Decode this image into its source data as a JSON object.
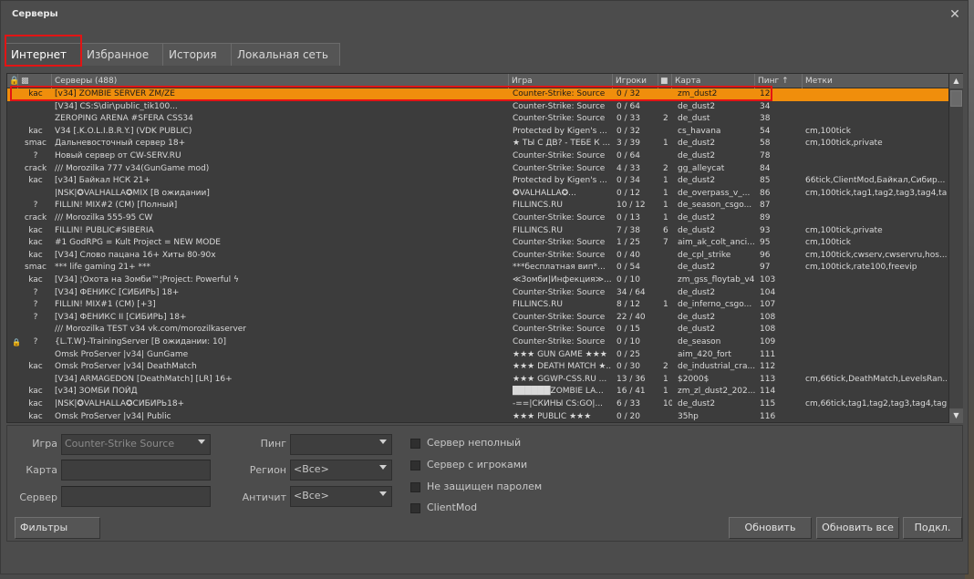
{
  "window": {
    "title": "Серверы",
    "close_glyph": "✕"
  },
  "tabs": [
    {
      "label": "Интернет"
    },
    {
      "label": "Избранное"
    },
    {
      "label": "История"
    },
    {
      "label": "Локальная сеть"
    }
  ],
  "columns": {
    "lock_icon": "lock-icon",
    "vac_icon": "vac-shield-icon",
    "servers": "Серверы (488)",
    "game": "Игра",
    "players": "Игроки",
    "bots_icon": "bot-icon",
    "map": "Карта",
    "ping": "Пинг ↑",
    "tags": "Метки"
  },
  "rows": [
    {
      "pw": "",
      "vac": "kac",
      "name": "[v34] ZOMBIE SERVER ZM/ZE",
      "game": "Counter-Strike: Source",
      "players": "0 / 32",
      "bots": "",
      "map": "zm_dust2",
      "ping": "12",
      "tags": "",
      "selected": true
    },
    {
      "pw": "",
      "vac": "",
      "name": "[V34] CS:S\\dir\\public_tik100...",
      "game": "Counter-Strike: Source",
      "players": "0 / 64",
      "bots": "",
      "map": "de_dust2",
      "ping": "34",
      "tags": ""
    },
    {
      "pw": "",
      "vac": "",
      "name": "ZEROPING ARENA #SFERA CSS34",
      "game": "Counter-Strike: Source",
      "players": "0 / 33",
      "bots": "2",
      "map": "de_dust",
      "ping": "38",
      "tags": ""
    },
    {
      "pw": "",
      "vac": "kac",
      "name": "V34 [.K.O.L.I.B.R.Y.] (VDK PUBLIC)",
      "game": "Protected by Kigen's ...",
      "players": "0 / 32",
      "bots": "",
      "map": "cs_havana",
      "ping": "54",
      "tags": "cm,100tick"
    },
    {
      "pw": "",
      "vac": "smac",
      "name": "Дальневосточный сервер 18+",
      "game": "★ ТЫ С ДВ? - ТЕБЕ К ...",
      "players": "3 / 39",
      "bots": "1",
      "map": "de_dust2",
      "ping": "58",
      "tags": "cm,100tick,private"
    },
    {
      "pw": "",
      "vac": "?",
      "name": "Новый сервер от CW-SERV.RU",
      "game": "Counter-Strike: Source",
      "players": "0 / 64",
      "bots": "",
      "map": "de_dust2",
      "ping": "78",
      "tags": ""
    },
    {
      "pw": "",
      "vac": "crack",
      "name": "/// Morozilka 777 v34(GunGame mod)",
      "game": "Counter-Strike: Source",
      "players": "4 / 33",
      "bots": "2",
      "map": "gg_alleycat",
      "ping": "84",
      "tags": ""
    },
    {
      "pw": "",
      "vac": "kac",
      "name": "[v34] Байкал НСК 21+",
      "game": "Protected by Kigen's ...",
      "players": "0 / 34",
      "bots": "1",
      "map": "de_dust2",
      "ping": "85",
      "tags": "66tick,ClientMod,Байкал,Сибир..."
    },
    {
      "pw": "",
      "vac": "",
      "name": "|NSK|✪VALHALLA✪MIX [В ожидании]",
      "game": "✪VALHALLA✪...",
      "players": "0 / 12",
      "bots": "1",
      "map": "de_overpass_v_...",
      "ping": "86",
      "tags": "cm,100tick,tag1,tag2,tag3,tag4,ta..."
    },
    {
      "pw": "",
      "vac": "?",
      "name": "FILLIN! MIX#2 (CM) [Полный]",
      "game": "FILLINCS.RU",
      "players": "10 / 12",
      "bots": "1",
      "map": "de_season_csgo...",
      "ping": "87",
      "tags": ""
    },
    {
      "pw": "",
      "vac": "crack",
      "name": "/// Morozilka 555-95 CW",
      "game": "Counter-Strike: Source",
      "players": "0 / 13",
      "bots": "1",
      "map": "de_dust2",
      "ping": "89",
      "tags": ""
    },
    {
      "pw": "",
      "vac": "kac",
      "name": "FILLIN! PUBLIC#SIBERIA",
      "game": "FILLINCS.RU",
      "players": "7 / 38",
      "bots": "6",
      "map": "de_dust2",
      "ping": "93",
      "tags": "cm,100tick,private"
    },
    {
      "pw": "",
      "vac": "kac",
      "name": "#1 GodRPG = Kult Project = NEW MODE",
      "game": "Counter-Strike: Source",
      "players": "1 / 25",
      "bots": "7",
      "map": "aim_ak_colt_anci...",
      "ping": "95",
      "tags": "cm,100tick"
    },
    {
      "pw": "",
      "vac": "kac",
      "name": "[V34] Слово пацана 16+ Хиты 80-90х",
      "game": "Counter-Strike: Source",
      "players": "0 / 40",
      "bots": "",
      "map": "de_cpl_strike",
      "ping": "96",
      "tags": "cm,100tick,cwserv,cwservru,hos..."
    },
    {
      "pw": "",
      "vac": "smac",
      "name": "*** life gaming 21+ ***",
      "game": "***бесплатная вип*...",
      "players": "0 / 54",
      "bots": "",
      "map": "de_dust2",
      "ping": "97",
      "tags": "cm,100tick,rate100,freevip"
    },
    {
      "pw": "",
      "vac": "kac",
      "name": "[V34] ¦Охота на Зомби™¦Project: Powerful ϟ",
      "game": "≪Зомби|Инфекция≫...",
      "players": "0 / 10",
      "bots": "",
      "map": "zm_gss_floytab_v4",
      "ping": "103",
      "tags": ""
    },
    {
      "pw": "",
      "vac": "?",
      "name": "[V34] ФЕНИКС [СИБИРЬ] 18+",
      "game": "Counter-Strike: Source",
      "players": "34 / 64",
      "bots": "",
      "map": "de_dust2",
      "ping": "104",
      "tags": ""
    },
    {
      "pw": "",
      "vac": "?",
      "name": "FILLIN! MIX#1 (CM) [+3]",
      "game": "FILLINCS.RU",
      "players": "8 / 12",
      "bots": "1",
      "map": "de_inferno_csgo...",
      "ping": "107",
      "tags": ""
    },
    {
      "pw": "",
      "vac": "?",
      "name": "[V34] ФЕНИКС II [СИБИРЬ] 18+",
      "game": "Counter-Strike: Source",
      "players": "22 / 40",
      "bots": "",
      "map": "de_dust2",
      "ping": "108",
      "tags": ""
    },
    {
      "pw": "",
      "vac": "",
      "name": "/// Morozilka TEST v34 vk.com/morozilkaserver",
      "game": "Counter-Strike: Source",
      "players": "0 / 15",
      "bots": "",
      "map": "de_dust2",
      "ping": "108",
      "tags": ""
    },
    {
      "pw": "lock",
      "vac": "?",
      "name": "{L.T.W}-TrainingServer [В ожидании: 10]",
      "game": "Counter-Strike: Source",
      "players": "0 / 10",
      "bots": "",
      "map": "de_season",
      "ping": "109",
      "tags": ""
    },
    {
      "pw": "",
      "vac": "",
      "name": "        Omsk ProServer |v34| GunGame",
      "game": "★★★ GUN GAME ★★★",
      "players": "0 / 25",
      "bots": "",
      "map": "aim_420_fort",
      "ping": "111",
      "tags": ""
    },
    {
      "pw": "",
      "vac": "kac",
      "name": "        Omsk ProServer |v34| DeathMatch",
      "game": "★★★ DEATH MATCH ★...",
      "players": "0 / 30",
      "bots": "2",
      "map": "de_industrial_cra...",
      "ping": "112",
      "tags": ""
    },
    {
      "pw": "",
      "vac": "",
      "name": "[V34] ARMAGEDON [DeathMatch] [LR] 16+",
      "game": "★★★ GGWP-CSS.RU ...",
      "players": "13 / 36",
      "bots": "1",
      "map": "$2000$",
      "ping": "113",
      "tags": "cm,66tick,DeathMatch,LevelsRan..."
    },
    {
      "pw": "",
      "vac": "kac",
      "name": "[v34] ЗОМБИ ПОЙД",
      "game": "██████ZOMBIE LA...",
      "players": "16 / 41",
      "bots": "1",
      "map": "zm_zl_dust2_202...",
      "ping": "114",
      "tags": ""
    },
    {
      "pw": "",
      "vac": "kac",
      "name": "|NSK|✪VALHALLA✪СИБИРЬ18+",
      "game": "-==|СКИНЫ CS:GO|...",
      "players": "6 / 33",
      "bots": "10",
      "map": "de_dust2",
      "ping": "115",
      "tags": "cm,66tick,tag1,tag2,tag3,tag4,tagr"
    },
    {
      "pw": "",
      "vac": "kac",
      "name": "        Omsk ProServer |v34| Public",
      "game": "★★★ PUBLIC ★★★",
      "players": "0 / 20",
      "bots": "",
      "map": "35hp",
      "ping": "116",
      "tags": ""
    }
  ],
  "scrollbar": {
    "up": "▲",
    "down": "▼"
  },
  "filters": {
    "game_label": "Игра",
    "game_value": "Counter-Strike Source",
    "map_label": "Карта",
    "map_value": "",
    "server_label": "Сервер",
    "server_value": "",
    "ping_label": "Пинг",
    "ping_value": "",
    "region_label": "Регион",
    "region_value": "<Все>",
    "anticheat_label": "Античит",
    "anticheat_value": "<Все>",
    "checkboxes": [
      {
        "label": "Сервер неполный",
        "checked": false
      },
      {
        "label": "Сервер с игроками",
        "checked": false
      },
      {
        "label": "Не защищен паролем",
        "checked": false
      },
      {
        "label": "ClientMod",
        "checked": false
      }
    ]
  },
  "buttons": {
    "filters": "Фильтры",
    "refresh": "Обновить",
    "refresh_all": "Обновить все",
    "connect": "Подкл."
  }
}
